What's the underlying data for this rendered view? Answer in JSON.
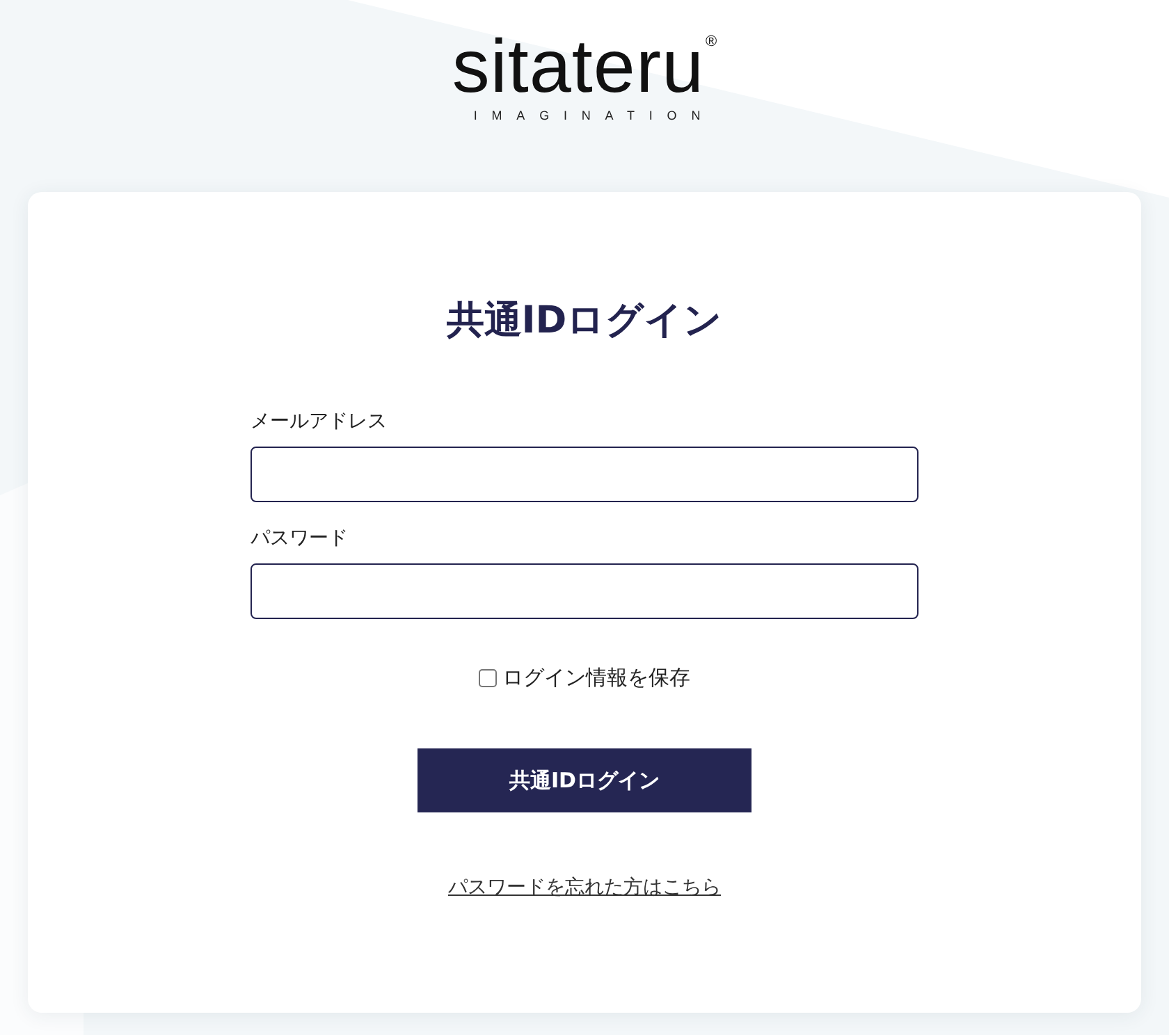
{
  "logo": {
    "wordmark": "sitateru",
    "registered": "®",
    "tagline": "IMAGINATION"
  },
  "login_form": {
    "title": "共通IDログイン",
    "fields": [
      {
        "label": "メールアドレス"
      },
      {
        "label": "パスワード"
      }
    ],
    "remember": {
      "label": "ログイン情報を保存",
      "checked": false
    },
    "submit_button": "共通IDログイン",
    "forgot_link": "パスワードを忘れた方はこちら"
  }
}
